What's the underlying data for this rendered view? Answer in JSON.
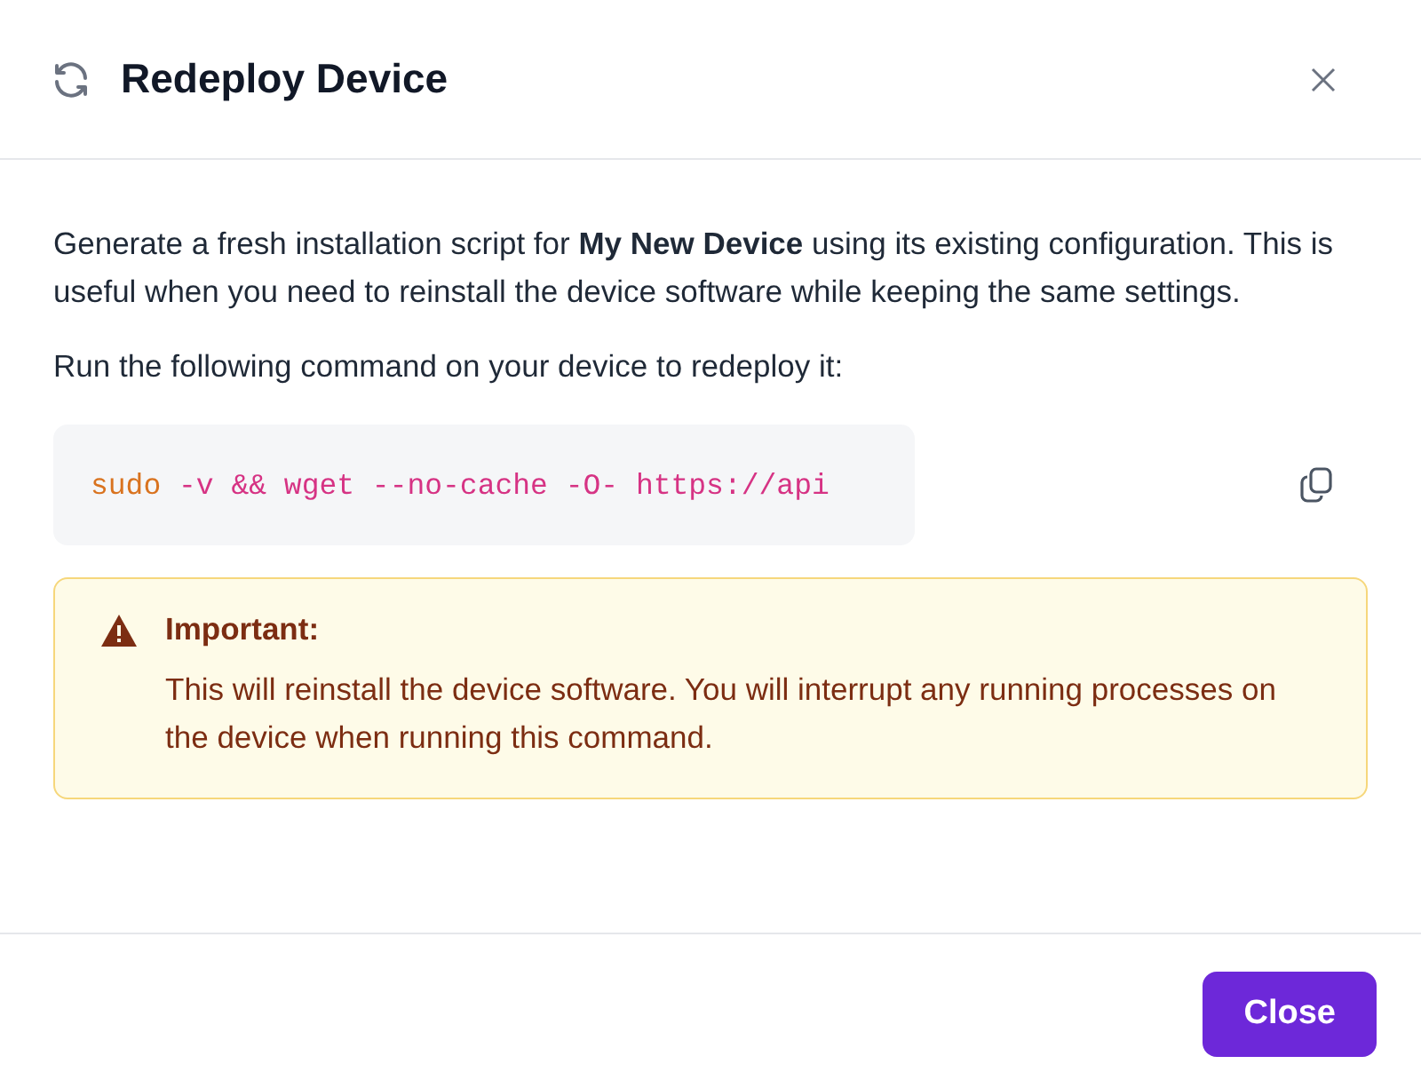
{
  "dialog": {
    "title": "Redeploy Device",
    "description": "Generate a fresh installation script for **My New Device** using its existing configuration. This is useful when you need to reinstall the device software while keeping the same settings.",
    "instruction": "Run the following command on your device to redeploy it:",
    "command": [
      {
        "kind": "keyword",
        "text": "sudo"
      },
      {
        "kind": "arg",
        "text": " -v && wget --no-cache -O- https://api"
      }
    ],
    "alert": {
      "title": "Important:",
      "message": "This will reinstall the device software. You will interrupt any running processes on the device when running this command."
    },
    "buttons": [
      {
        "label": "Close",
        "kind": "primary"
      }
    ]
  }
}
